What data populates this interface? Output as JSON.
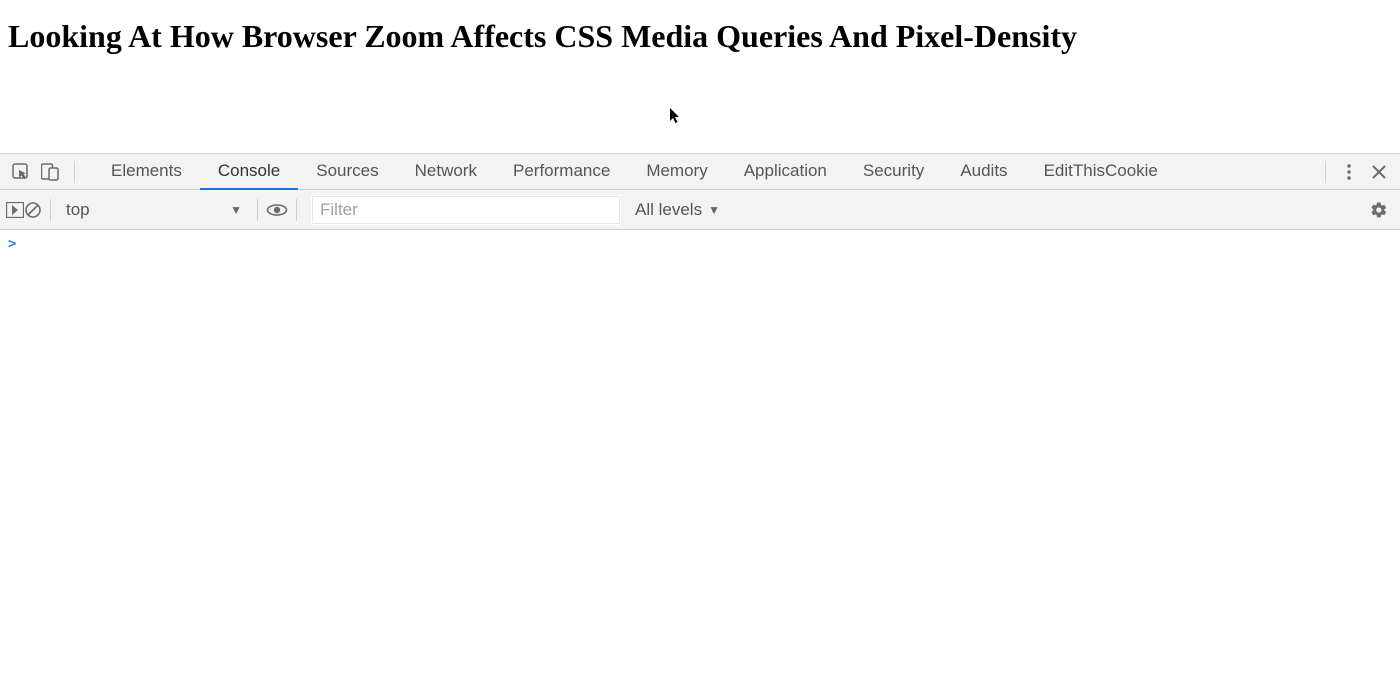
{
  "page": {
    "heading": "Looking At How Browser Zoom Affects CSS Media Queries And Pixel-Density"
  },
  "devtools": {
    "tabs": [
      {
        "label": "Elements"
      },
      {
        "label": "Console"
      },
      {
        "label": "Sources"
      },
      {
        "label": "Network"
      },
      {
        "label": "Performance"
      },
      {
        "label": "Memory"
      },
      {
        "label": "Application"
      },
      {
        "label": "Security"
      },
      {
        "label": "Audits"
      },
      {
        "label": "EditThisCookie"
      }
    ],
    "active_tab": "Console",
    "toolbar": {
      "context_selected": "top",
      "filter_placeholder": "Filter",
      "levels_label": "All levels"
    },
    "console": {
      "prompt": ">"
    }
  }
}
